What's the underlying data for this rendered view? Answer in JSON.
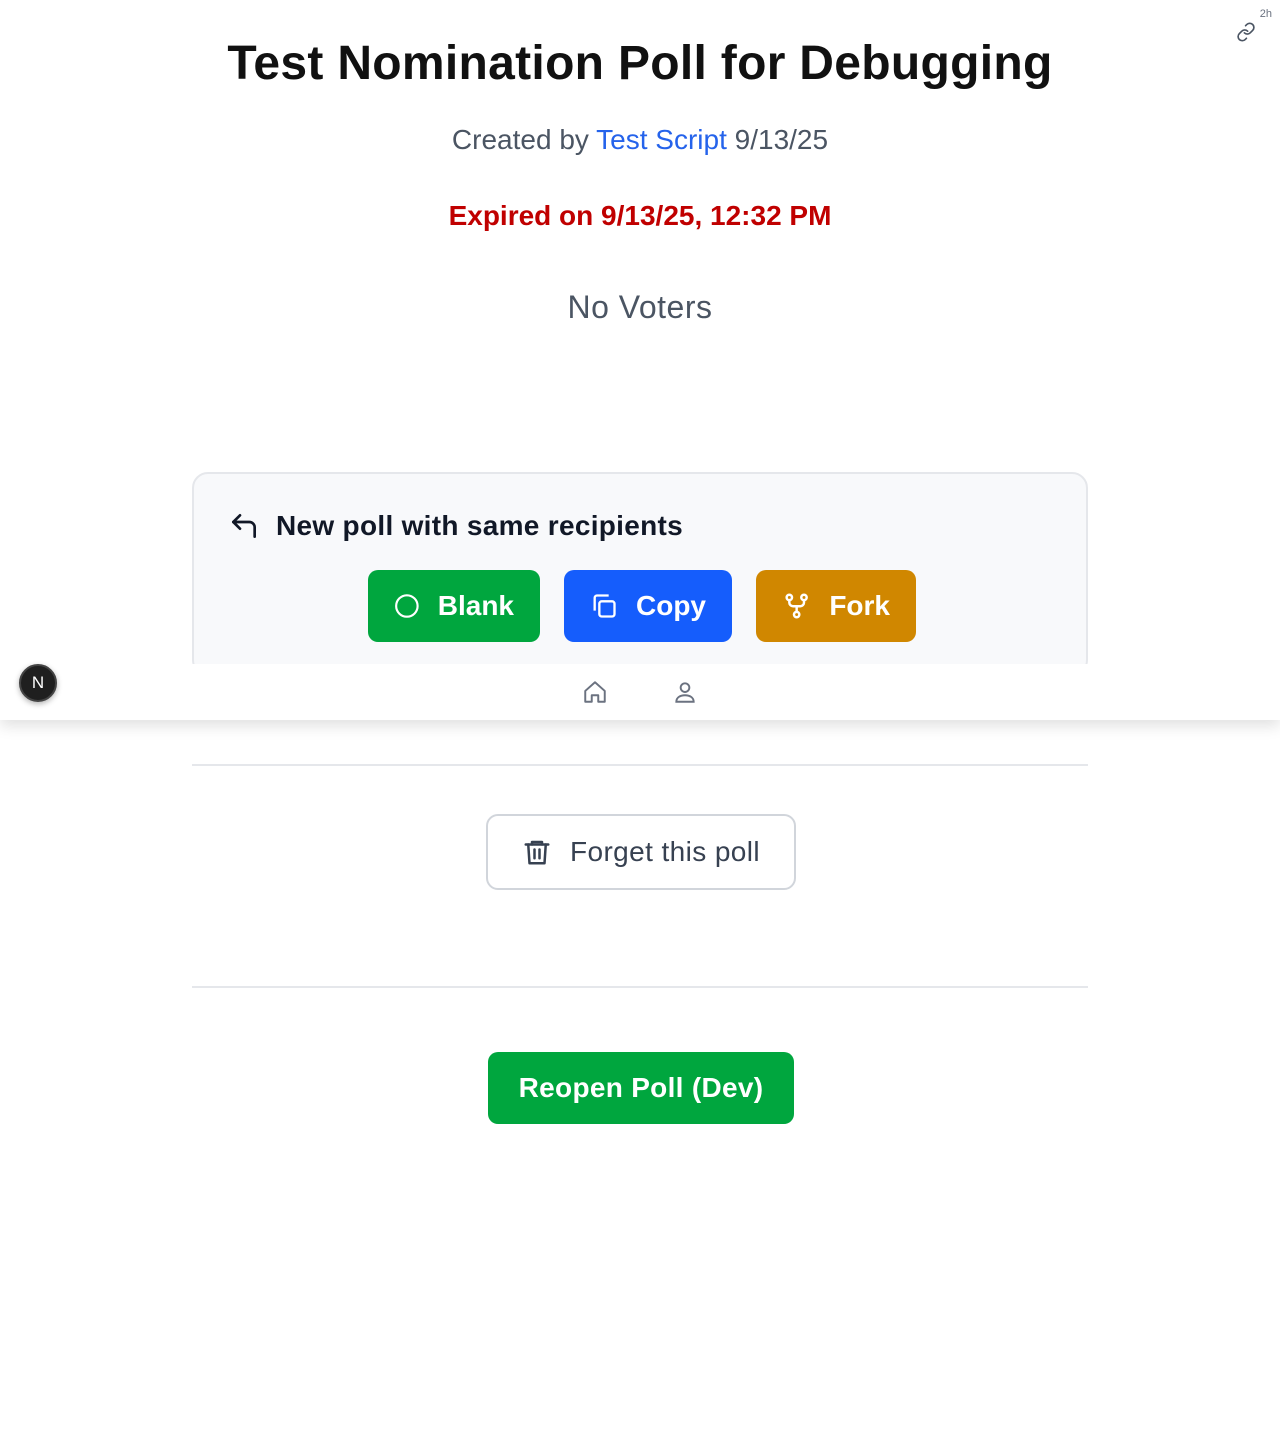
{
  "poll": {
    "title": "Test Nomination Poll for Debugging",
    "created_prefix": "Created by",
    "creator": "Test Script",
    "created_date": "9/13/25",
    "expired_text": "Expired on 9/13/25, 12:32 PM",
    "voters_text": "No Voters"
  },
  "header": {
    "age_badge": "2h",
    "share_icon": "link-icon"
  },
  "new_poll_card": {
    "heading": "New poll with same recipients",
    "heading_icon": "reply-arrow-icon",
    "buttons": [
      {
        "label": "Blank",
        "icon": "circle-icon",
        "color": "#00a63e"
      },
      {
        "label": "Copy",
        "icon": "copy-icon",
        "color": "#155dfc"
      },
      {
        "label": "Fork",
        "icon": "fork-icon",
        "color": "#d08700"
      }
    ]
  },
  "bottom_nav": {
    "items": [
      {
        "icon": "home-icon"
      },
      {
        "icon": "user-icon"
      }
    ]
  },
  "dev_badge": {
    "label": "N"
  },
  "actions": {
    "forget_label": "Forget this poll",
    "forget_icon": "trash-icon",
    "reopen_label": "Reopen Poll (Dev)"
  },
  "colors": {
    "expired": "#c00000",
    "link": "#2563eb",
    "green": "#00a63e"
  }
}
